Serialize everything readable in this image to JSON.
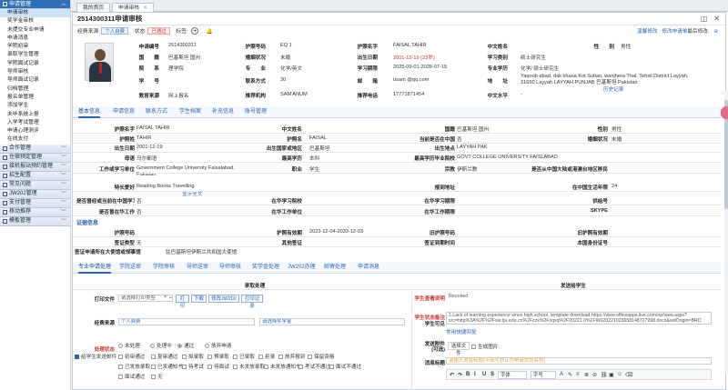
{
  "sidebar": {
    "groups_top": [
      {
        "label": "申请管理"
      }
    ],
    "items": [
      "申请审核",
      "奖学金审核",
      "未提交专业申请",
      "申请消息",
      "学院初审",
      "录取学生管理",
      "学院面试记录",
      "导师审核",
      "导师面试记录",
      "归档管理",
      "报名单管理",
      "添加学生",
      "未毕系统上报",
      "入学考试管理",
      "申请心理测评",
      "在线支付"
    ],
    "groups_bottom": [
      "合作管理",
      "住宿预定管理",
      "接机报站预约管理",
      "招生配置",
      "常见问题",
      "JW202管理",
      "支付管理",
      "移动推荐",
      "模板管理"
    ]
  },
  "tabs": [
    {
      "label": "我的首页"
    },
    {
      "label": "申请审核"
    }
  ],
  "window": {
    "title": "2514300311申请审核",
    "controls": [
      "◫",
      "✕"
    ]
  },
  "status": {
    "submit_label": "经费来源:",
    "submit_badge": "个人自费",
    "state_label": "状态:",
    "state_badge": "已通过",
    "tag_label": "标签:",
    "plus": "+",
    "bell": "🔔",
    "links": [
      "温馨修改",
      "修改申请单",
      "最后修改:"
    ]
  },
  "profile": [
    {
      "l": "申请编号",
      "v": "2514300311"
    },
    {
      "l": "护照号码",
      "v": "EQ          1"
    },
    {
      "l": "护照名字",
      "v": "FAISAL TAHIR"
    },
    {
      "l": "中文姓名",
      "v": ""
    },
    {
      "l": "性　　别",
      "v": "男性"
    },
    {
      "l": "国　　籍",
      "v": "巴基斯坦 国州"
    },
    {
      "l": "婚姻状况",
      "v": "未婚"
    },
    {
      "l": "出生日期",
      "v": "2001-12-19 (23岁)"
    },
    {
      "l": "学习类别",
      "v": "硕士研究生"
    },
    {
      "l": "院　　系",
      "v": "理学院"
    },
    {
      "l": "专　　业",
      "v": "化学/英文"
    },
    {
      "l": "学习期限",
      "v": "2025-09-01-2028-07-15"
    },
    {
      "l": "专业学历",
      "v": "化学/ 硕士研究生"
    },
    {
      "l": "学　　号",
      "v": ""
    },
    {
      "l": "联系方式",
      "v": "30          "
    },
    {
      "l": "邮　　箱",
      "v": "usam          @qq.com"
    },
    {
      "l": "地　　址",
      "v": "Yaqoob abad, dak khana Kot Sultan, wanjhera Thal, Tehsil District Layyah, 31650 Layyah LAYYAH PUNJAB 巴基斯坦 Pakistan"
    },
    {
      "l": "",
      "v": "历史记录"
    },
    {
      "l": "教育来源",
      "v": "网上报名"
    },
    {
      "l": "推荐机构",
      "v": "SAM ANUM"
    },
    {
      "l": "推荐电话",
      "v": "17771871454"
    },
    {
      "l": "中文水平",
      "v": "-"
    }
  ],
  "info_tabs": [
    "基本信息",
    "申请信息",
    "联系方式",
    "学生档案",
    "补充信息",
    "账号管理"
  ],
  "basic": [
    {
      "l": "护照名字",
      "v": "FAISAL TAHIR"
    },
    {
      "l": "中文姓名",
      "v": ""
    },
    {
      "l": "国籍",
      "v": "巴基斯坦 国州"
    },
    {
      "l": "性别",
      "v": "男性"
    },
    {
      "l": "护照姓",
      "v": "TAHIR"
    },
    {
      "l": "护照名",
      "v": "FAISAL"
    },
    {
      "l": "当前是否在中国",
      "v": "否"
    },
    {
      "l": "婚姻状况",
      "v": "未婚"
    },
    {
      "l": "出生日期",
      "v": "2001-12-19"
    },
    {
      "l": "出生国家或地区",
      "v": "巴基斯坦"
    },
    {
      "l": "出生地点",
      "v": "LAYYAH PAK"
    },
    {
      "l": "母语",
      "v": "乌尔都语"
    },
    {
      "l": "最高学历",
      "v": "本科"
    },
    {
      "l": "最高学历毕业院校",
      "v": "GOVT COLLEGE UNIVERSITY FAISLABAD"
    },
    {
      "l": "工作或学习单位",
      "v": "Government College University Faisalabad, Pakistan"
    },
    {
      "l": "职业",
      "v": "学生"
    },
    {
      "l": "宗教",
      "v": "伊斯兰教"
    },
    {
      "l": "是否从中国大陆或港澳台地区移民",
      "v": ""
    },
    {
      "l": "特长爱好",
      "v": "Reading Books Travelling"
    },
    {
      "l": "",
      "v": "显示全文"
    },
    {
      "l": "报到地址",
      "v": ""
    },
    {
      "l": "在中国生活年限",
      "v": "24"
    },
    {
      "l": "是否曾经或当前在中国学习",
      "v": "否"
    },
    {
      "l": "在华学习院校",
      "v": ""
    },
    {
      "l": "在华学习期限",
      "v": ""
    },
    {
      "l": "供给号",
      "v": ""
    },
    {
      "l": "是否曾在华工作",
      "v": "否"
    },
    {
      "l": "在华工作单位",
      "v": ""
    },
    {
      "l": "在华工作期限",
      "v": ""
    },
    {
      "l": "SKYPE",
      "v": ""
    }
  ],
  "cert": {
    "title": "证据信息",
    "rows": [
      {
        "l": "护照号码",
        "v": ""
      },
      {
        "l": "护照有效期",
        "v": "2023-12-04-2033-12-03"
      },
      {
        "l": "旧护照号码",
        "v": ""
      },
      {
        "l": "旧护照有效期",
        "v": ""
      },
      {
        "l": "签证类型",
        "v": "无"
      },
      {
        "l": "其他签证",
        "v": ""
      },
      {
        "l": "签证到期时间",
        "v": ""
      },
      {
        "l": "本国身份证号",
        "v": ""
      }
    ],
    "note_l": "签证申请所在大使馆或领事馆",
    "note_v": "驻巴基斯坦伊斯兰共和国大使馆"
  },
  "proc_tabs": [
    "专业申请处理",
    "学院送审",
    "学院审核",
    "导师送审",
    "导师审核",
    "奖学金处理",
    "JW202办理",
    "邮寄处理",
    "申请消息"
  ],
  "proc": {
    "left_title": "录取处理",
    "right_title": "发送给学生",
    "print_label": "打印文件",
    "print_placeholder": "请选择打印类型",
    "print_btns": [
      "打印",
      "下载",
      "修改JW202",
      "打印记录"
    ],
    "fund_label": "经费来源",
    "fund_value": "个人自费",
    "scholar_placeholder": "请选择奖学金",
    "state_label": "处理状态",
    "send_label": "给学生发送邮件",
    "radios": [
      "未处理",
      "处理中",
      "通过",
      "放弃申请"
    ],
    "row1": [
      "初审通过",
      "复审通过",
      "拟录取",
      "预录取",
      "已录取",
      "拒录",
      "放弃报到",
      "保留资格"
    ],
    "row2": [
      "已发放录取",
      "已发通知书",
      "待考试",
      "待面试",
      "未发放录取",
      "未发放通知书",
      "考试不通过",
      "面试不通过"
    ],
    "row3": [
      "面试通过",
      "无"
    ],
    "reason_label": "学生查看说明",
    "reason_value": "Revoked",
    "remark_label": "学生状态备注",
    "remark_sub": "学生可见",
    "remark_value": "1.Lack of learning experience since high school, template download:https://view.officeapps.live.com/op/view.aspx?src=http%3A%2F%2Fsie.tju.edu.cn%2Fzzx%2Fsqxq%2F20221 0%2FW020221023658148727998.docx&wdOrigin=BRO",
    "quick": "常用快捷回复",
    "attach_label": "发送附件",
    "attach_sub": "(可选)",
    "attach_btn": "选择文件",
    "attach_cb": "生成图片",
    "msg_label": "消息标题",
    "msg_placeholder": "请输入消息标题(不填写默认为申请状态名称)",
    "editor_font": "字体",
    "editor_size": "字号"
  }
}
